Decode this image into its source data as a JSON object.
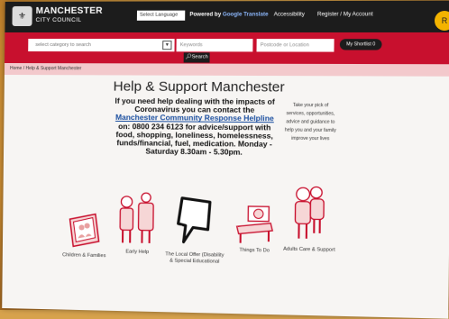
{
  "header": {
    "logo_icon": "crest",
    "logo_line1": "MANCHESTER",
    "logo_line2": "CITY COUNCIL",
    "language_select": "Select Language",
    "powered_by": "Powered by",
    "translate_brand": "Google Translate",
    "accessibility": "Accessibility",
    "register": "Register / My Account"
  },
  "search": {
    "category_placeholder": "select category to search",
    "keyword_placeholder": "Keywords",
    "postcode_placeholder": "Postcode or Location",
    "shortlist_label": "My Shortlist",
    "shortlist_count": "0",
    "search_button": "Search"
  },
  "breadcrumb": "Home / Help & Support Manchester",
  "main": {
    "title": "Help & Support Manchester",
    "notice_part1": "If you need help dealing with the impacts of Coronavirus you can contact the",
    "notice_link": "Manchester Community Response Helpline",
    "notice_part2": "on: 0800 234 6123 for advice/support with food, shopping, loneliness, homelessness, funds/financial, fuel, medication. Monday - Saturday 8.30am - 5.30pm.",
    "side_text": "Take your pick of services, opportunities, advice and guidance to help you and your family improve your lives"
  },
  "tiles": [
    {
      "icon": "family-picture-icon",
      "label": "Children & Families"
    },
    {
      "icon": "early-help-icon",
      "label": "Early Help"
    },
    {
      "icon": "speech-bubble-icon",
      "label": "The Local Offer (Disability & Special Educational"
    },
    {
      "icon": "park-bench-icon",
      "label": "Things To Do"
    },
    {
      "icon": "adult-care-icon",
      "label": "Adults Care & Support"
    }
  ],
  "corner_badge": "R"
}
